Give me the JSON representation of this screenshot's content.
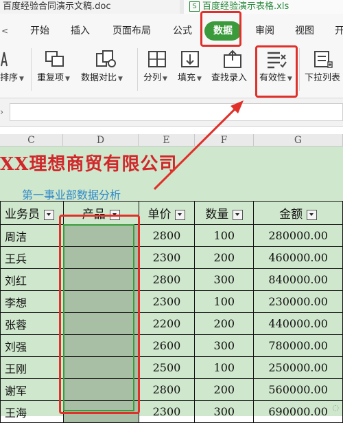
{
  "tabs": {
    "doc_title": "百度经验合同演示文稿.doc",
    "sheet_title": "百度经验演示表格.xls",
    "sheet_badge": "S"
  },
  "menu": {
    "items": [
      "开始",
      "插入",
      "页面布局",
      "公式",
      "数据",
      "审阅",
      "视图",
      "开"
    ],
    "active": "数据",
    "collapse_caret": "<"
  },
  "ribbon": {
    "items": [
      "排序",
      "重复项",
      "数据对比",
      "分列",
      "填充",
      "查找录入",
      "有效性",
      "下拉列表"
    ]
  },
  "columns": [
    "C",
    "D",
    "E",
    "F",
    "G"
  ],
  "sheet": {
    "title": "XX理想商贸有限公司",
    "subtitle": "第一事业部数据分析",
    "headers": [
      "业务员",
      "产品",
      "单价",
      "数量",
      "金额"
    ],
    "rows": [
      {
        "name": "周洁",
        "price": "2800",
        "qty": "100",
        "amount": "280000.00"
      },
      {
        "name": "王兵",
        "price": "2300",
        "qty": "200",
        "amount": "460000.00"
      },
      {
        "name": "刘红",
        "price": "2800",
        "qty": "300",
        "amount": "840000.00"
      },
      {
        "name": "李想",
        "price": "2300",
        "qty": "100",
        "amount": "230000.00"
      },
      {
        "name": "张蓉",
        "price": "2200",
        "qty": "200",
        "amount": "440000.00"
      },
      {
        "name": "刘强",
        "price": "2600",
        "qty": "300",
        "amount": "780000.00"
      },
      {
        "name": "王刚",
        "price": "2500",
        "qty": "100",
        "amount": "250000.00"
      },
      {
        "name": "谢军",
        "price": "2800",
        "qty": "200",
        "amount": "560000.00"
      },
      {
        "name": "王海",
        "price": "2300",
        "qty": "300",
        "amount": "690000.00"
      }
    ]
  },
  "colors": {
    "accent_green": "#3b9b3c",
    "annotation_red": "#e0302a",
    "title_red": "#d1262a",
    "subtitle_blue": "#2f88c9",
    "sheet_bg": "#cfe7cc"
  }
}
